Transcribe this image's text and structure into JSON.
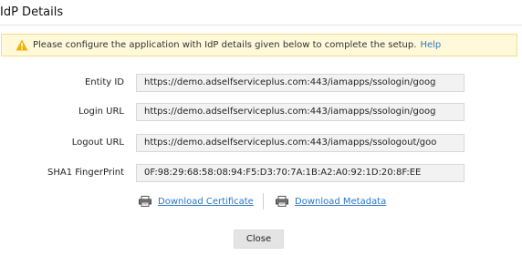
{
  "dialog": {
    "title": "IdP Details"
  },
  "notice": {
    "icon": "warning-icon",
    "message": "Please configure the application with IdP details given below to complete the setup.",
    "help_link": "Help"
  },
  "fields": [
    {
      "label": "Entity ID",
      "value": "https://demo.adselfserviceplus.com:443/iamapps/ssologin/goog"
    },
    {
      "label": "Login URL",
      "value": "https://demo.adselfserviceplus.com:443/iamapps/ssologin/goog"
    },
    {
      "label": "Logout URL",
      "value": "https://demo.adselfserviceplus.com:443/iamapps/ssologout/goo"
    },
    {
      "label": "SHA1 FingerPrint",
      "value": "0F:98:29:68:58:08:94:F5:D3:70:7A:1B:A2:A0:92:1D:20:8F:EE"
    }
  ],
  "downloads": {
    "certificate_label": "Download Certificate",
    "metadata_label": "Download Metadata",
    "icon": "printer-icon"
  },
  "footer": {
    "close_label": "Close"
  },
  "colors": {
    "link": "#2a77c6",
    "notice_bg": "#fff8d9",
    "notice_border": "#f3dc8c",
    "warning": "#f0b400"
  }
}
